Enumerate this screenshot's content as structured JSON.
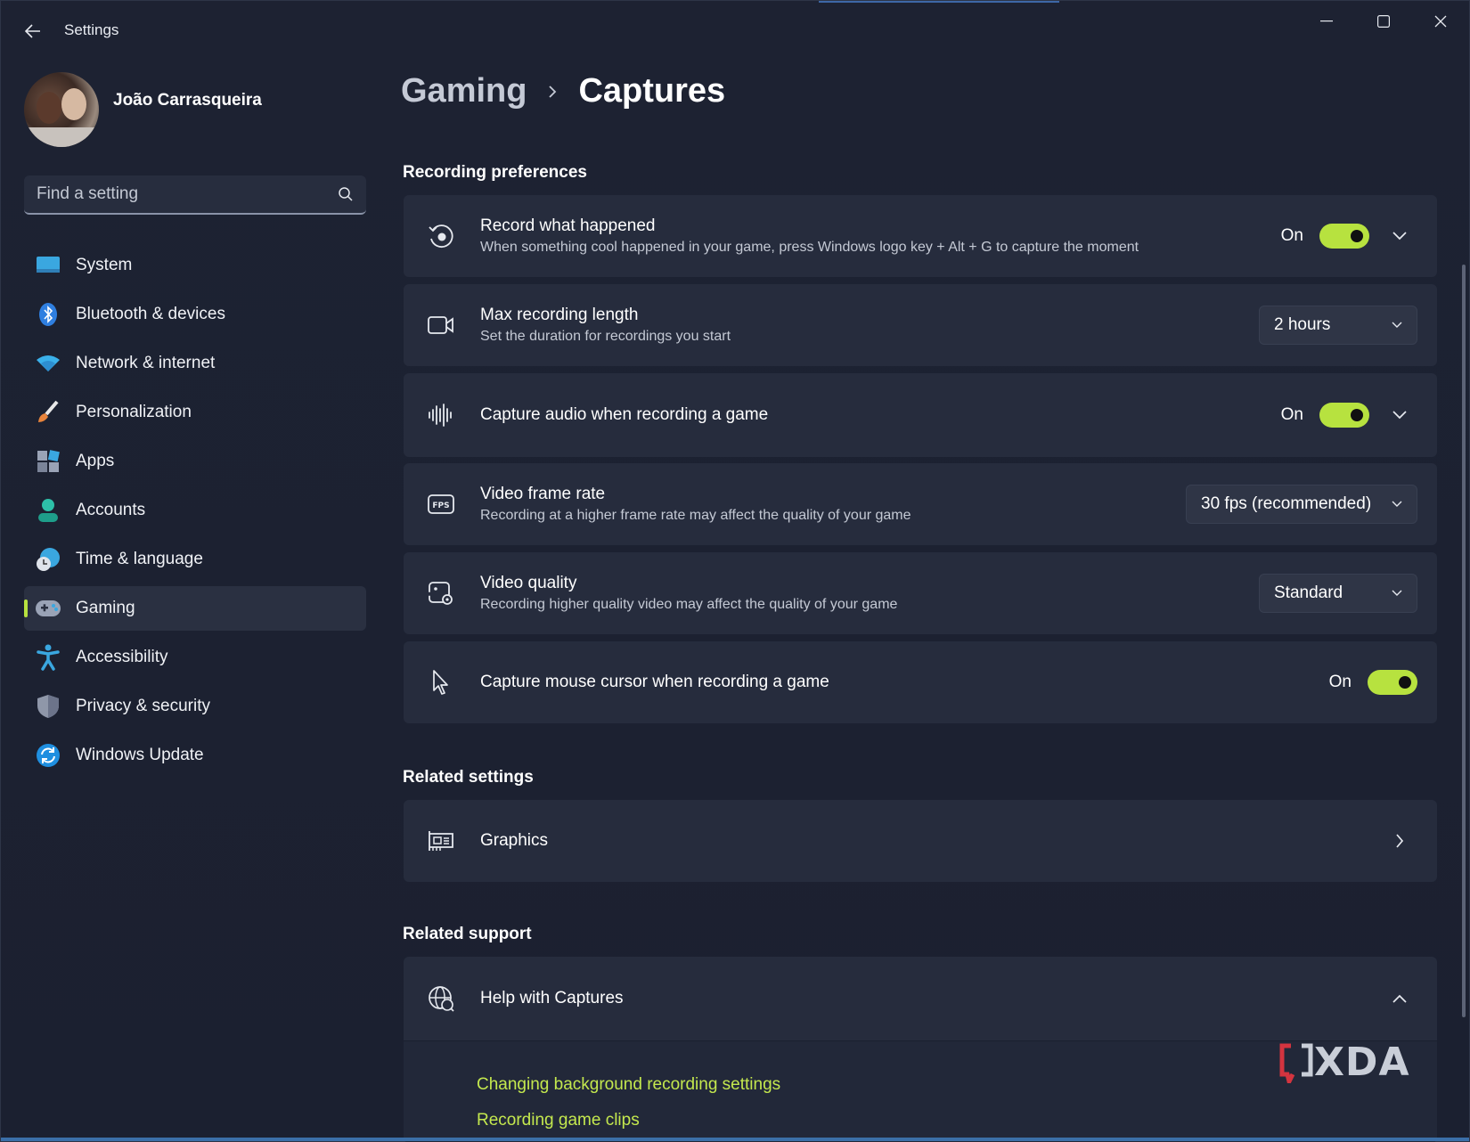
{
  "window": {
    "title": "Settings"
  },
  "profile": {
    "name": "João Carrasqueira"
  },
  "search": {
    "placeholder": "Find a setting"
  },
  "sidebar": {
    "items": [
      {
        "label": "System",
        "icon": "monitor-icon"
      },
      {
        "label": "Bluetooth & devices",
        "icon": "bluetooth-icon"
      },
      {
        "label": "Network & internet",
        "icon": "wifi-icon"
      },
      {
        "label": "Personalization",
        "icon": "brush-icon"
      },
      {
        "label": "Apps",
        "icon": "apps-icon"
      },
      {
        "label": "Accounts",
        "icon": "person-icon"
      },
      {
        "label": "Time & language",
        "icon": "globe-clock-icon"
      },
      {
        "label": "Gaming",
        "icon": "gamepad-icon",
        "active": true
      },
      {
        "label": "Accessibility",
        "icon": "accessibility-icon"
      },
      {
        "label": "Privacy & security",
        "icon": "shield-icon"
      },
      {
        "label": "Windows Update",
        "icon": "update-icon"
      }
    ]
  },
  "breadcrumb": {
    "parent": "Gaming",
    "current": "Captures"
  },
  "sections": {
    "recording": "Recording preferences",
    "related_settings": "Related settings",
    "related_support": "Related support"
  },
  "settings": {
    "record_what_happened": {
      "title": "Record what happened",
      "subtitle": "When something cool happened in your game, press Windows logo key + Alt + G to capture the moment",
      "state": "On"
    },
    "max_recording_length": {
      "title": "Max recording length",
      "subtitle": "Set the duration for recordings you start",
      "value": "2 hours"
    },
    "capture_audio": {
      "title": "Capture audio when recording a game",
      "state": "On"
    },
    "video_frame_rate": {
      "title": "Video frame rate",
      "subtitle": "Recording at a higher frame rate may affect the quality of your game",
      "value": "30 fps (recommended)"
    },
    "video_quality": {
      "title": "Video quality",
      "subtitle": "Recording higher quality video may affect the quality of your game",
      "value": "Standard"
    },
    "capture_mouse": {
      "title": "Capture mouse cursor when recording a game",
      "state": "On"
    }
  },
  "related": {
    "graphics": "Graphics"
  },
  "support": {
    "title": "Help with Captures",
    "links": [
      "Changing background recording settings",
      "Recording game clips"
    ]
  },
  "watermark": "XDA",
  "colors": {
    "accent": "#b7e23f",
    "link": "#c4e84e",
    "card": "#262c3d",
    "background": "#1c2233"
  }
}
